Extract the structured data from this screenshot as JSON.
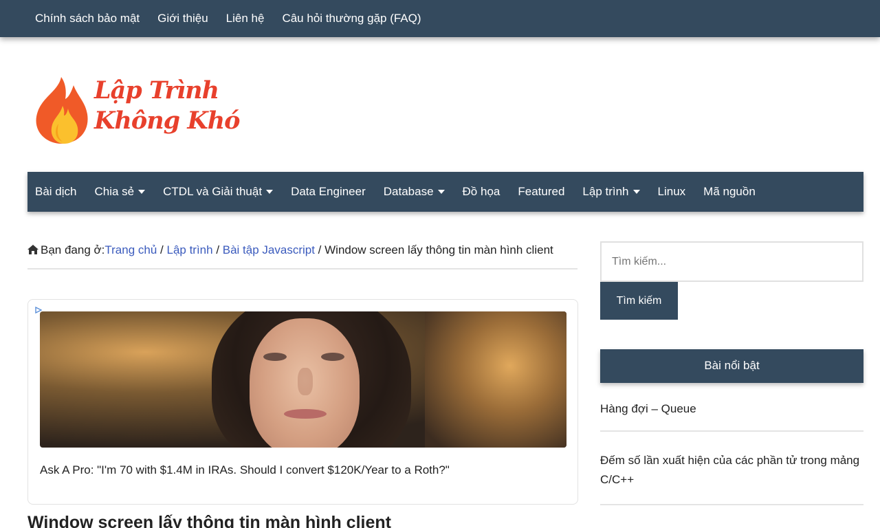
{
  "top_menu": [
    "Chính sách bảo mật",
    "Giới thiệu",
    "Liên hệ",
    "Câu hỏi thường gặp (FAQ)"
  ],
  "logo": {
    "line1": "Lập Trình",
    "line2": "Không Khó",
    "colors": {
      "flame_outer": "#f05a28",
      "flame_inner": "#fbc02d",
      "text": "#e8402c"
    }
  },
  "main_nav": [
    {
      "label": "Bài dịch",
      "dropdown": false
    },
    {
      "label": "Chia sẻ",
      "dropdown": true
    },
    {
      "label": "CTDL và Giải thuật",
      "dropdown": true
    },
    {
      "label": "Data Engineer",
      "dropdown": false
    },
    {
      "label": "Database",
      "dropdown": true
    },
    {
      "label": "Đồ họa",
      "dropdown": false
    },
    {
      "label": "Featured",
      "dropdown": false
    },
    {
      "label": "Lập trình",
      "dropdown": true
    },
    {
      "label": "Linux",
      "dropdown": false
    },
    {
      "label": "Mã nguồn",
      "dropdown": false
    }
  ],
  "breadcrumb": {
    "prefix": "Bạn đang ở:",
    "links": [
      "Trang chủ",
      "Lập trình",
      "Bài tập Javascript"
    ],
    "separator": " / ",
    "current": "Window screen lấy thông tin màn hình client"
  },
  "ad": {
    "caption": "Ask A Pro: \"I'm 70 with $1.4M in IRAs. Should I convert $120K/Year to a Roth?\""
  },
  "post": {
    "title": "Window screen lấy thông tin màn hình client"
  },
  "sidebar": {
    "search": {
      "placeholder": "Tìm kiếm...",
      "button": "Tìm kiếm"
    },
    "featured": {
      "title": "Bài nổi bật",
      "items": [
        "Hàng đợi – Queue",
        "Đếm số lần xuất hiện của các phần tử trong mảng C/C++"
      ]
    }
  },
  "colors": {
    "nav_bg": "#344a5e",
    "link": "#3b5bbd"
  },
  "icons": {
    "breadcrumb_home": "home-icon",
    "dropdown": "caret-down-icon",
    "ad_choice": "adchoices-icon"
  }
}
